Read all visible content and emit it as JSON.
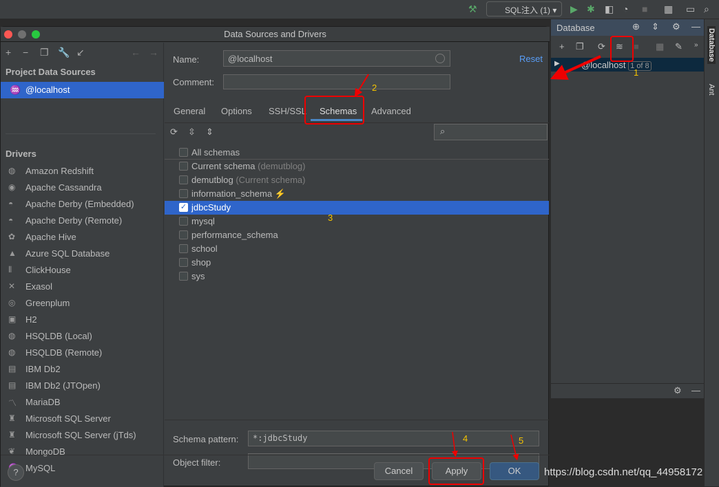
{
  "ide": {
    "run_config": "SQL注入 (1)",
    "db_panel_title": "Database",
    "tree_item": "@localhost",
    "tree_badge": "1 of 8",
    "stripe_database": "Database",
    "stripe_ant": "Ant",
    "watermark": "https://blog.csdn.net/qq_44958172"
  },
  "dialog": {
    "title": "Data Sources and Drivers",
    "left": {
      "project_header": "Project Data Sources",
      "project_item": "@localhost",
      "drivers_header": "Drivers",
      "drivers": [
        "Amazon Redshift",
        "Apache Cassandra",
        "Apache Derby (Embedded)",
        "Apache Derby (Remote)",
        "Apache Hive",
        "Azure SQL Database",
        "ClickHouse",
        "Exasol",
        "Greenplum",
        "H2",
        "HSQLDB (Local)",
        "HSQLDB (Remote)",
        "IBM Db2",
        "IBM Db2 (JTOpen)",
        "MariaDB",
        "Microsoft SQL Server",
        "Microsoft SQL Server (jTds)",
        "MongoDB",
        "MySQL"
      ]
    },
    "name_label": "Name:",
    "name_value": "@localhost",
    "comment_label": "Comment:",
    "comment_value": "",
    "reset": "Reset",
    "tabs": [
      "General",
      "Options",
      "SSH/SSL",
      "Schemas",
      "Advanced"
    ],
    "active_tab": "Schemas",
    "schemas": [
      {
        "name": "All schemas",
        "hint": "",
        "checked": false
      },
      {
        "name": "Current schema",
        "hint": "(demutblog)",
        "checked": false
      },
      {
        "name": "demutblog",
        "hint": "(Current schema)",
        "checked": false
      },
      {
        "name": "information_schema",
        "hint": "⚡",
        "checked": false
      },
      {
        "name": "jdbcStudy",
        "hint": "",
        "checked": true
      },
      {
        "name": "mysql",
        "hint": "",
        "checked": false
      },
      {
        "name": "performance_schema",
        "hint": "",
        "checked": false
      },
      {
        "name": "school",
        "hint": "",
        "checked": false
      },
      {
        "name": "shop",
        "hint": "",
        "checked": false
      },
      {
        "name": "sys",
        "hint": "",
        "checked": false
      }
    ],
    "schema_pattern_label": "Schema pattern:",
    "schema_pattern_value": "*:jdbcStudy",
    "object_filter_label": "Object filter:",
    "object_filter_value": "",
    "cancel": "Cancel",
    "apply": "Apply",
    "ok": "OK",
    "help": "?"
  },
  "annotations": [
    "1",
    "2",
    "3",
    "4",
    "5"
  ],
  "colors": {
    "selection": "#2f65ca",
    "annotation_red": "#ee0000",
    "annotation_yellow": "#f5c400",
    "link": "#589df6"
  }
}
